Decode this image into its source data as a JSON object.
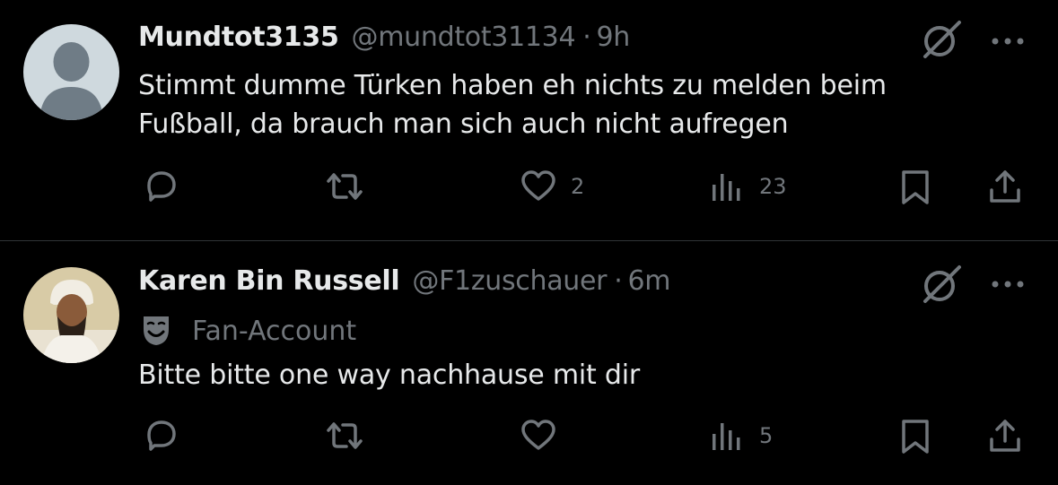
{
  "tweets": [
    {
      "display_name": "Mundtot3135",
      "handle": "@mundtot31134",
      "time": "9h",
      "text_lines": [
        "Stimmt dumme Türken haben eh nichts zu melden beim",
        "Fußball, da brauch man sich auch nicht aufregen"
      ],
      "avatar": "default-avatar",
      "likes": "2",
      "views": "23"
    },
    {
      "display_name": "Karen Bin Russell",
      "handle": "@F1zuschauer",
      "time": "6m",
      "badge_icon": "theater-mask-icon",
      "badge_label": "Fan-Account",
      "text_lines": [
        "Bitte bitte one way nachhause mit dir"
      ],
      "avatar": "photo-avatar",
      "likes": "",
      "views": "5"
    }
  ],
  "separator": "·",
  "colors": {
    "background": "#000000",
    "primary_text": "#e7e9ea",
    "secondary_text": "#71767b",
    "divider": "#2f3336"
  },
  "icons": [
    "reply-icon",
    "retweet-icon",
    "like-icon",
    "views-icon",
    "bookmark-icon",
    "share-icon",
    "grok-icon",
    "more-icon"
  ]
}
